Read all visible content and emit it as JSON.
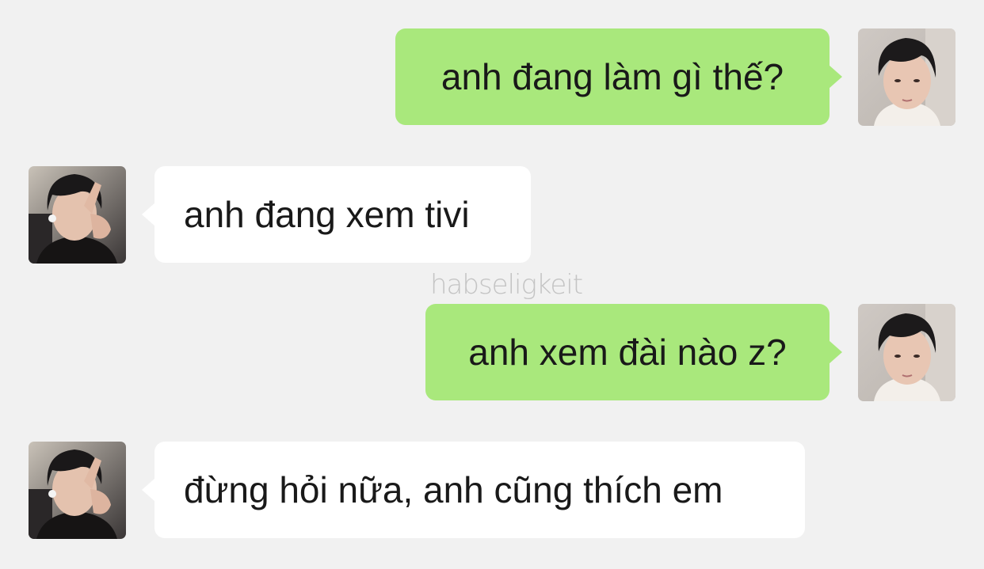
{
  "conversation": {
    "messages": [
      {
        "sender": "me",
        "text": "anh đang làm gì thế?"
      },
      {
        "sender": "other",
        "text": "anh đang xem tivi"
      },
      {
        "sender": "me",
        "text": "anh xem đài nào z?"
      },
      {
        "sender": "other",
        "text": "đừng hỏi nữa, anh cũng thích em"
      }
    ]
  },
  "watermark": "habseligkeit",
  "colors": {
    "background": "#f1f1f1",
    "sent_bubble": "#a9e87c",
    "received_bubble": "#ffffff",
    "text": "#191919",
    "watermark": "#c4c4c4"
  }
}
